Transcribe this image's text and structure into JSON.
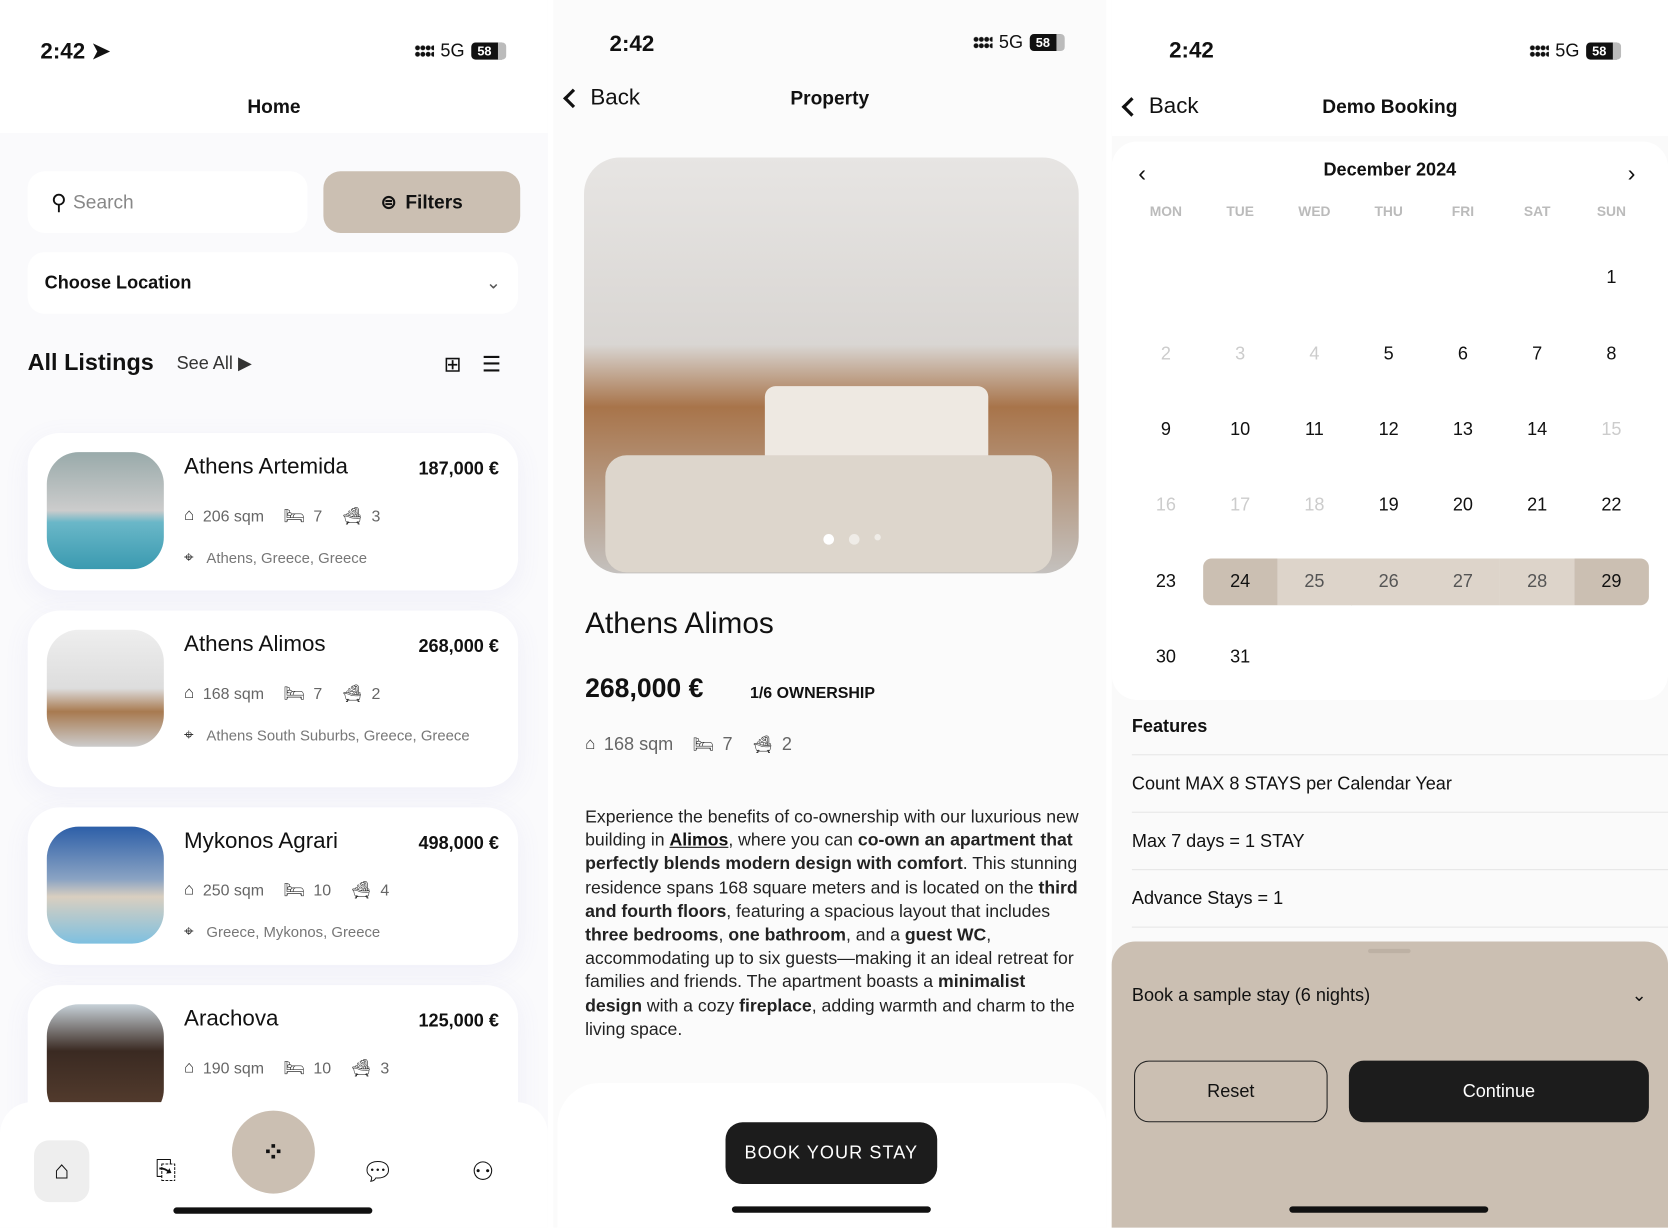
{
  "status_bar": {
    "time": "2:42",
    "network": "5G",
    "battery": "58"
  },
  "home": {
    "title": "Home",
    "search_placeholder": "Search",
    "filters_label": "Filters",
    "location_label": "Choose Location",
    "section_title": "All Listings",
    "see_all": "See All",
    "listings": [
      {
        "name": "Athens Artemida",
        "price": "187,000 €",
        "area": "206 sqm",
        "beds": "7",
        "baths": "3",
        "location": "Athens, Greece, Greece"
      },
      {
        "name": "Athens Alimos",
        "price": "268,000 €",
        "area": "168 sqm",
        "beds": "7",
        "baths": "2",
        "location": "Athens South Suburbs, Greece, Greece"
      },
      {
        "name": "Mykonos Agrari",
        "price": "498,000 €",
        "area": "250 sqm",
        "beds": "10",
        "baths": "4",
        "location": "Greece, Mykonos, Greece"
      },
      {
        "name": "Arachova",
        "price": "125,000 €",
        "area": "190 sqm",
        "beds": "10",
        "baths": "3",
        "location": ""
      }
    ],
    "tabs": [
      "home-icon",
      "bookmark-icon",
      "grid-icon",
      "chat-icon",
      "profile-icon"
    ]
  },
  "property": {
    "back": "Back",
    "title": "Property",
    "name": "Athens Alimos",
    "price": "268,000 €",
    "ownership": "1/6 OWNERSHIP",
    "area": "168 sqm",
    "beds": "7",
    "baths": "2",
    "description": [
      {
        "t": "Experience the benefits of co-ownership with our luxurious new building in "
      },
      {
        "t": "Alimos",
        "link": true
      },
      {
        "t": ", where you can "
      },
      {
        "t": "co-own an apartment that perfectly blends modern design with comfort",
        "b": true
      },
      {
        "t": ". This stunning residence spans 168 square meters and is located on the "
      },
      {
        "t": "third and fourth floors",
        "b": true
      },
      {
        "t": ", featuring a spacious layout that includes "
      },
      {
        "t": "three bedrooms",
        "b": true
      },
      {
        "t": ", "
      },
      {
        "t": "one bathroom",
        "b": true
      },
      {
        "t": ", and a "
      },
      {
        "t": "guest WC",
        "b": true
      },
      {
        "t": ", accommodating up to six guests—making it an ideal retreat for families and friends. The apartment boasts a "
      },
      {
        "t": "minimalist design",
        "b": true
      },
      {
        "t": " with a cozy "
      },
      {
        "t": "fireplace",
        "b": true
      },
      {
        "t": ", adding warmth and charm to the living space."
      }
    ],
    "book_label": "BOOK YOUR STAY"
  },
  "booking": {
    "back": "Back",
    "title": "Demo Booking",
    "month": "December  2024",
    "weekdays": [
      "MON",
      "TUE",
      "WED",
      "THU",
      "FRI",
      "SAT",
      "SUN"
    ],
    "first_weekday_index": 6,
    "days_in_month": 31,
    "disabled_days": [
      2,
      3,
      4,
      15,
      16,
      17,
      18
    ],
    "range_start": 24,
    "range_end": 29,
    "features_title": "Features",
    "features": [
      "Count MAX 8 STAYS per Calendar Year",
      "Max 7 days = 1 STAY",
      "Advance Stays = 1"
    ],
    "stay_option": "Book a sample stay (6 nights)",
    "reset_label": "Reset",
    "continue_label": "Continue",
    "accent": "#cbbfb2"
  }
}
